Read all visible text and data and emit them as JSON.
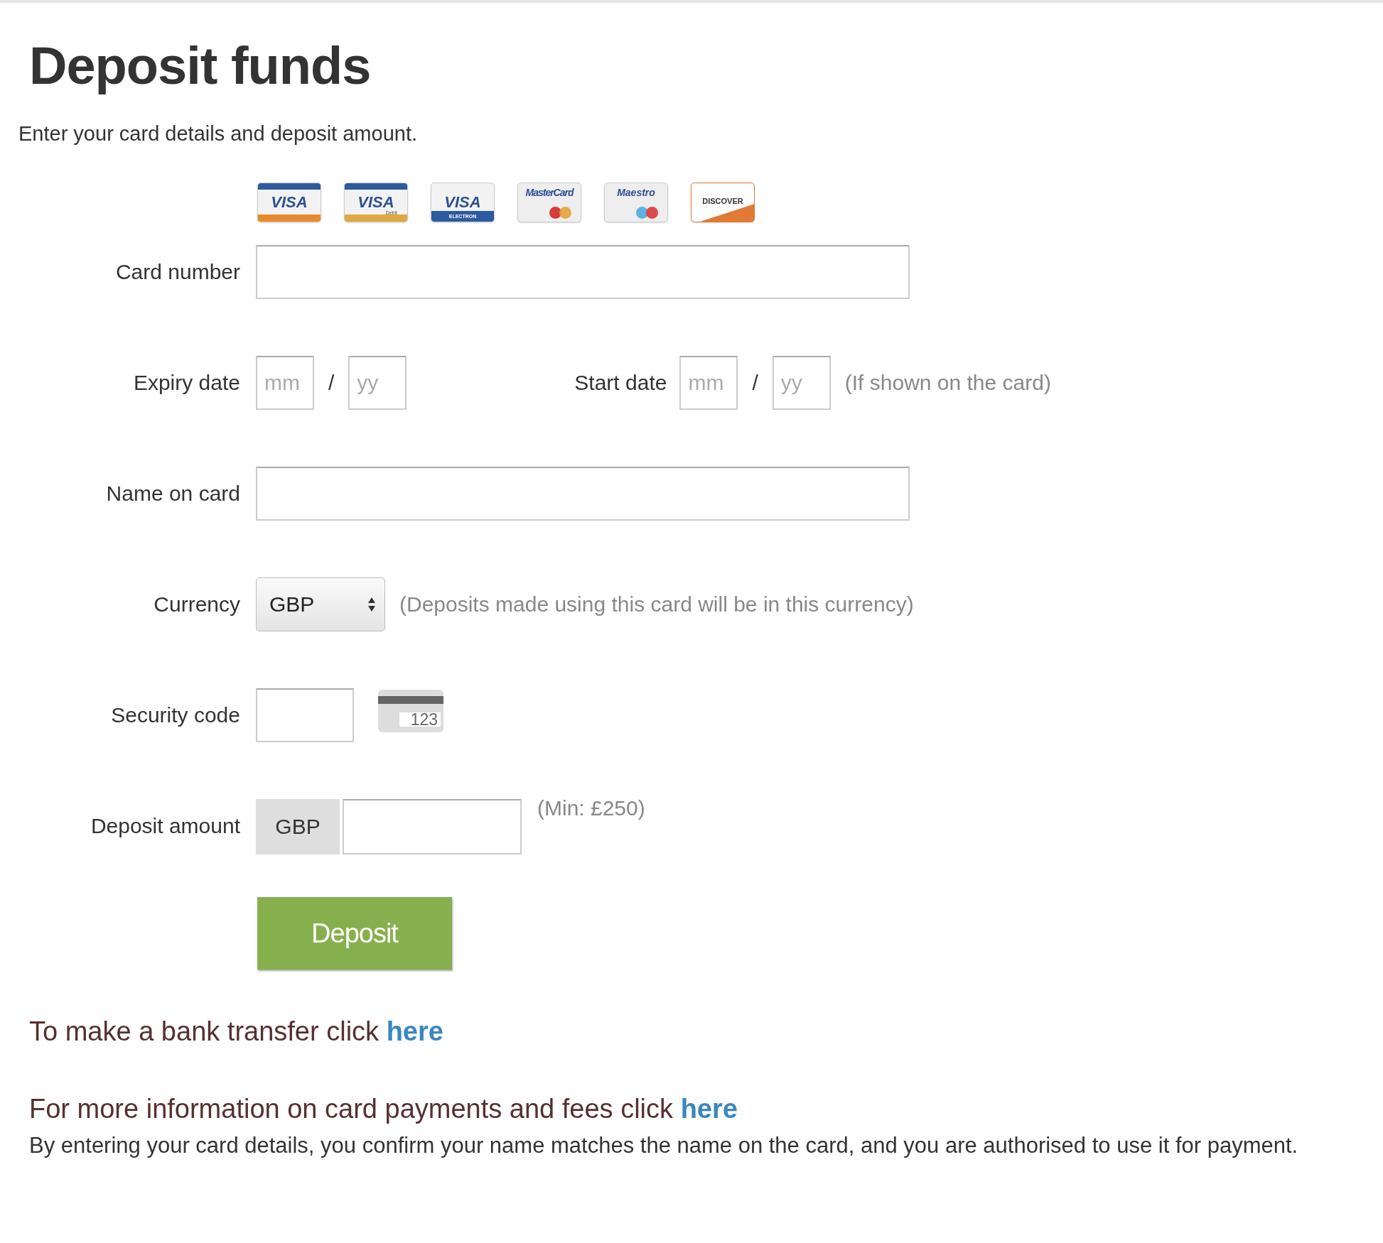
{
  "title": "Deposit funds",
  "intro": "Enter your card details and deposit amount.",
  "cards": [
    {
      "kind": "visa",
      "label": "VISA"
    },
    {
      "kind": "visa_debit",
      "label": "VISA",
      "sublabel": "Debit"
    },
    {
      "kind": "visa_electron",
      "label": "VISA",
      "sublabel": "ELECTRON"
    },
    {
      "kind": "mastercard",
      "label": "MasterCard"
    },
    {
      "kind": "maestro",
      "label": "Maestro"
    },
    {
      "kind": "discover",
      "label": "DISCOVER"
    }
  ],
  "rows": [
    {
      "kind": "text",
      "label": "Card number"
    },
    {
      "kind": "dates",
      "groups": [
        {
          "label": "Expiry date",
          "month_placeholder": "mm",
          "separator": "/",
          "year_placeholder": "yy"
        },
        {
          "label": "Start date",
          "month_placeholder": "mm",
          "separator": "/",
          "year_placeholder": "yy"
        }
      ],
      "note": "(If shown on the card)"
    },
    {
      "kind": "text",
      "label": "Name on card"
    },
    {
      "kind": "select",
      "label": "Currency",
      "value": "GBP",
      "note": "(Deposits made using this card will be in this currency)"
    },
    {
      "kind": "security",
      "label": "Security code",
      "icon_digits": "123"
    },
    {
      "kind": "amount",
      "label": "Deposit amount",
      "prefix": "GBP",
      "note": "(Min: £250)"
    }
  ],
  "button": "Deposit",
  "links": [
    {
      "text": "To make a bank transfer click",
      "link": "here"
    },
    {
      "text": "For more information on card payments and fees click",
      "link": "here"
    }
  ],
  "disclaimer": "By entering your card details, you confirm your name matches the name on the card, and you are authorised to use it for payment."
}
